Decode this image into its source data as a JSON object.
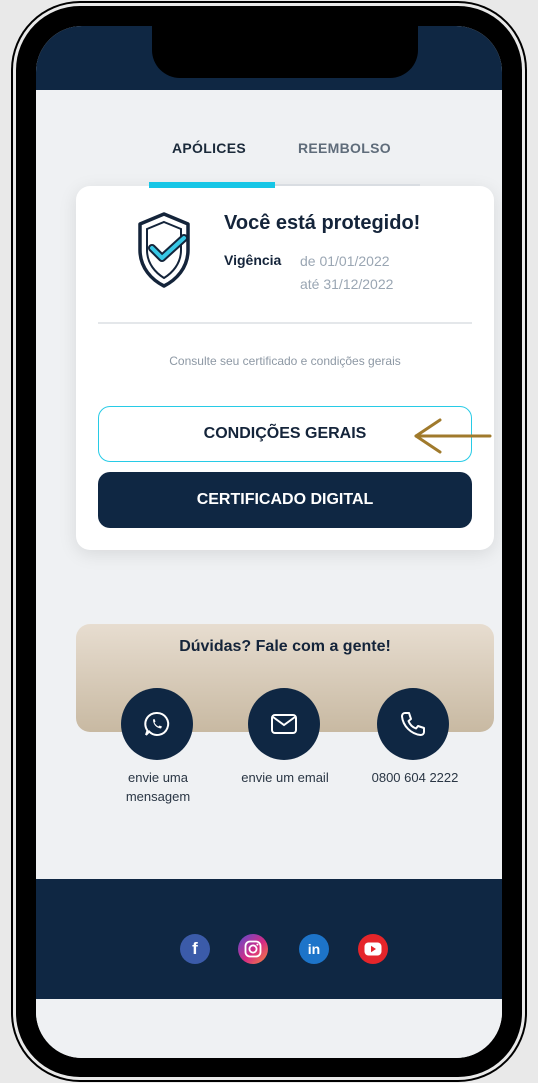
{
  "tabs": {
    "policies": "APÓLICES",
    "refund": "REEMBOLSO"
  },
  "card": {
    "title": "Você está protegido!",
    "validity_label": "Vigência",
    "validity_from": "de 01/01/2022",
    "validity_to": "até 31/12/2022",
    "hint": "Consulte seu certificado e condições gerais",
    "general_conditions_button": "CONDIÇÕES GERAIS",
    "digital_certificate_button": "CERTIFICADO DIGITAL"
  },
  "help": {
    "title": "Dúvidas? Fale com a gente!",
    "contacts": [
      {
        "icon": "whatsapp-icon",
        "label_line1": "envie uma",
        "label_line2": "mensagem"
      },
      {
        "icon": "email-icon",
        "label_line1": "envie um email",
        "label_line2": ""
      },
      {
        "icon": "phone-icon",
        "label_line1": "0800 604 2222",
        "label_line2": ""
      }
    ]
  },
  "social": [
    {
      "icon": "facebook-icon",
      "glyph": "f"
    },
    {
      "icon": "instagram-icon",
      "glyph": ""
    },
    {
      "icon": "linkedin-icon",
      "glyph": "in"
    },
    {
      "icon": "youtube-icon",
      "glyph": ""
    }
  ],
  "colors": {
    "navy": "#0f2743",
    "accent_cyan": "#17c6e6",
    "arrow": "#a07a2c"
  }
}
